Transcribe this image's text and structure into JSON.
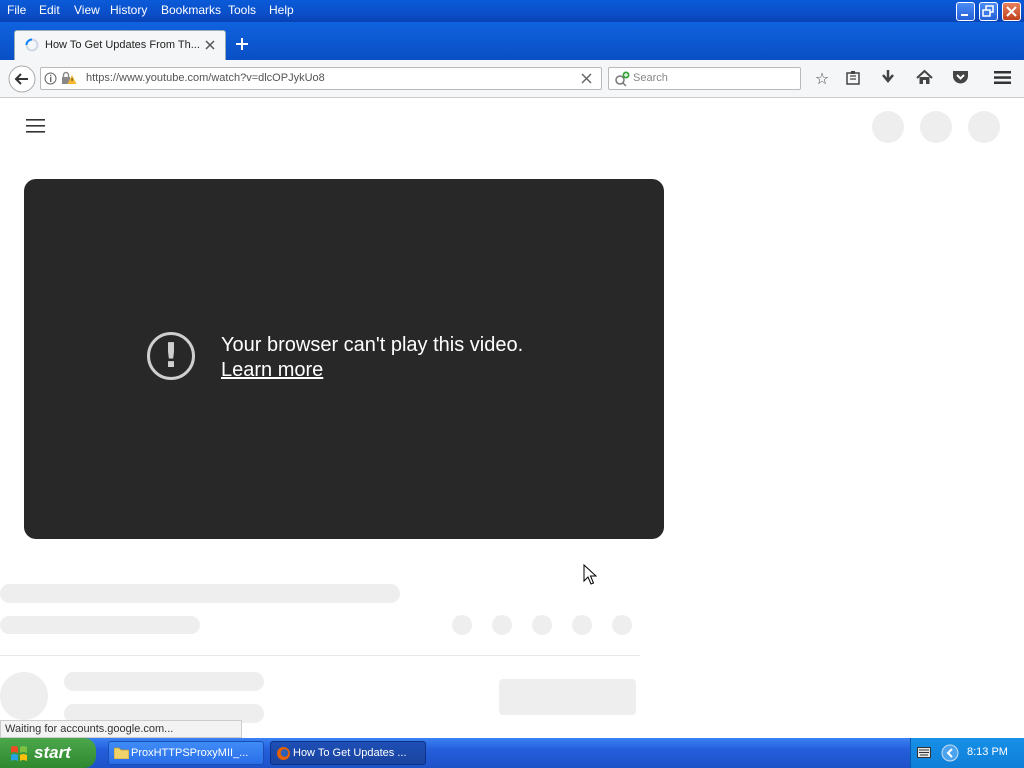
{
  "menu": {
    "items": [
      "File",
      "Edit",
      "View",
      "History",
      "Bookmarks",
      "Tools",
      "Help"
    ]
  },
  "tab": {
    "title": "How To Get Updates From Th..."
  },
  "navbar": {
    "url": "https://www.youtube.com/watch?v=dlcOPJykUo8",
    "search_placeholder": "Search"
  },
  "video": {
    "error_message": "Your browser can't play this video.",
    "learn_more": "Learn more"
  },
  "status": {
    "text": "Waiting for accounts.google.com..."
  },
  "taskbar": {
    "start_label": "start",
    "items": [
      "ProxHTTPSProxyMII_...",
      "How To Get Updates ..."
    ],
    "clock": "8:13 PM"
  },
  "icons": {
    "back": "back-arrow-icon",
    "info": "info-icon",
    "lock_warning": "lock-warning-icon",
    "star": "bookmark-star-icon",
    "library": "library-icon",
    "download": "download-icon",
    "home": "home-icon",
    "pocket": "pocket-icon",
    "menu": "hamburger-menu-icon"
  },
  "colors": {
    "title_blue": "#0b4fc9",
    "video_bg": "#282828",
    "skeleton": "#eeeeee",
    "start_green": "#2f8a2f"
  }
}
